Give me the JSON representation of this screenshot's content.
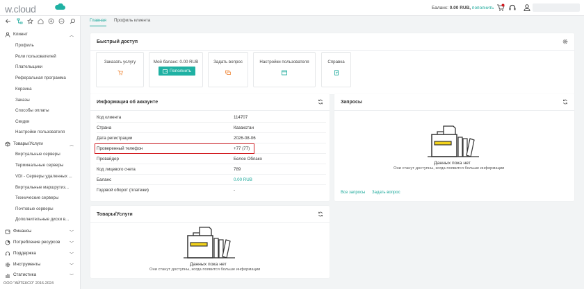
{
  "topbar": {
    "logo": "w.cloud",
    "balance_label": "Баланс:",
    "balance_value": "0.00 RUB,",
    "balance_link": "пополнить"
  },
  "tabs": [
    {
      "label": "Главная",
      "active": true
    },
    {
      "label": "Профиль клиента",
      "active": false
    }
  ],
  "sidebar": {
    "sections": [
      {
        "label": "Клиент",
        "icon": "user-icon",
        "expanded": true,
        "items": [
          "Профиль",
          "Роли пользователей",
          "Плательщики",
          "Реферальная программа",
          "Корзина",
          "Заказы",
          "Способы оплаты",
          "Скидки",
          "Настройки пользователя"
        ]
      },
      {
        "label": "Товары/Услуги",
        "icon": "box-icon",
        "expanded": true,
        "items": [
          "Виртуальные серверы",
          "Терминальные серверы",
          "VDI - Серверы удаленных ...",
          "Виртуальные маршрутиз...",
          "Технические серверы",
          "Почтовые серверы",
          "Дополнительные диски в..."
        ]
      },
      {
        "label": "Финансы",
        "icon": "wallet-icon",
        "expanded": false,
        "items": []
      },
      {
        "label": "Потребление ресурсов",
        "icon": "pie-icon",
        "expanded": false,
        "items": []
      },
      {
        "label": "Поддержка",
        "icon": "support-icon",
        "expanded": false,
        "items": []
      },
      {
        "label": "Инструменты",
        "icon": "gear-icon",
        "expanded": false,
        "items": []
      },
      {
        "label": "Статистика",
        "icon": "chart-icon",
        "expanded": false,
        "items": []
      }
    ],
    "copyright": "ООО \"АЙТЕКСО\" 2016-2024"
  },
  "quick_access": {
    "title": "Быстрый доступ",
    "tiles": [
      {
        "label": "Заказать услугу",
        "icon": "cart-icon"
      },
      {
        "label": "Мой баланс: 0.00 RUB",
        "icon": "wallet-icon",
        "button": "Пополнить"
      },
      {
        "label": "Задать вопрос",
        "icon": "chat-icon"
      },
      {
        "label": "Настройки пользователя",
        "icon": "settings-icon"
      },
      {
        "label": "Справка",
        "icon": "book-icon"
      }
    ]
  },
  "account": {
    "title": "Информация об аккаунте",
    "rows": [
      {
        "key": "Код клиента",
        "value": "114707"
      },
      {
        "key": "Страна",
        "value": "Казахстан"
      },
      {
        "key": "Дата регистрации",
        "value": "2026-08-06"
      },
      {
        "key": "Проверенный телефон",
        "value": "+77 (77)"
      },
      {
        "key": "Провайдер",
        "value": "Белое Облако"
      },
      {
        "key": "Код лицевого счета",
        "value": "789"
      },
      {
        "key": "Баланс",
        "value": "0.00 RUB"
      },
      {
        "key": "Годовой оборот (платежи)",
        "value": "-"
      }
    ]
  },
  "requests": {
    "title": "Запросы",
    "empty_title": "Данных пока нет",
    "empty_sub": "Они станут доступны, когда появится больше информации",
    "link_all": "Все запросы",
    "link_ask": "Задать вопрос"
  },
  "products": {
    "title": "Товары/Услуги",
    "empty_title": "Данных пока нет",
    "empty_sub": "Они станут доступны, когда появится больше информации"
  },
  "colors": {
    "accent": "#1aa89a",
    "highlight": "#d21d22",
    "empty_yellow": "#f2d21b"
  }
}
